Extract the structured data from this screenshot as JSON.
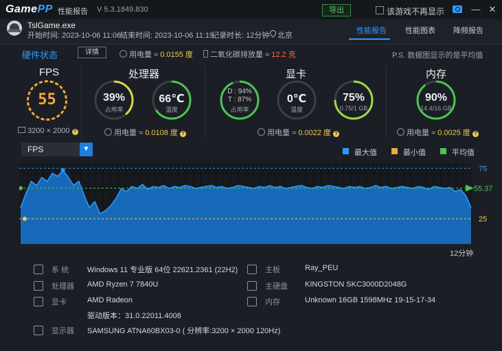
{
  "titlebar": {
    "logo_main": "Game",
    "logo_accent": "PP",
    "title": "性能报告",
    "version": "V 5.3.1849.830",
    "export_label": "导出",
    "checkbox_label": "该游戏不再显示"
  },
  "game": {
    "name": "TslGame.exe",
    "start": "开始时间: 2023-10-06 11:06",
    "end": "结束时间: 2023-10-06 11:19",
    "duration": "记录时长: 12分钟",
    "location": "北京"
  },
  "tabs": [
    "性能报告",
    "性能图表",
    "降频报告"
  ],
  "hw": {
    "title": "硬件状态",
    "detail_btn": "详情",
    "power_label": "用电量 ≈",
    "power_value": "0.0155 度",
    "co2_label": "二氧化碳排放量 ≈",
    "co2_value": "12.2 克",
    "note": "P.S. 数据图显示的是平均值"
  },
  "fps": {
    "title": "FPS",
    "value": "55",
    "resolution": "3200 × 2000"
  },
  "cpu": {
    "title": "处理器",
    "usage_value": "39%",
    "usage_label": "占用率",
    "usage_pct": 39,
    "temp_value": "66℃",
    "temp_label": "温度",
    "temp_pct": 66,
    "power_label": "用电量 ≈",
    "power_value": "0.0108 度"
  },
  "gpu": {
    "title": "显卡",
    "d_line": "D : 94%",
    "t_line": "T : 87%",
    "usage_label": "占用率",
    "usage_pct": 94,
    "temp_value": "0℃",
    "temp_label": "温度",
    "temp_pct": 0,
    "mem_value": "75%",
    "mem_detail": "0.75/1 GB",
    "mem_pct": 75,
    "power_label": "用电量 ≈",
    "power_value": "0.0022 度"
  },
  "ram": {
    "title": "内存",
    "value": "90%",
    "detail": "14.4/16 GB",
    "pct": 90,
    "power_label": "用电量 ≈",
    "power_value": "0.0025 度"
  },
  "chart_select": "FPS",
  "legend": [
    {
      "label": "最大值",
      "color": "#2e9bff"
    },
    {
      "label": "最小值",
      "color": "#f2a93b"
    },
    {
      "label": "平均值",
      "color": "#4cc552"
    }
  ],
  "chart_data": {
    "type": "area",
    "title": "",
    "xlabel": "12分钟",
    "ylabel": "",
    "max_line": 75,
    "avg_line": 55.37,
    "min_line": 25,
    "ylim": [
      0,
      80
    ],
    "series": [
      {
        "name": "FPS",
        "values": [
          36,
          50,
          62,
          58,
          66,
          62,
          70,
          67,
          73,
          66,
          58,
          62,
          48,
          36,
          42,
          30,
          33,
          38,
          45,
          55,
          52,
          57,
          55,
          59,
          54,
          57,
          56,
          58,
          55,
          57,
          56,
          58,
          57,
          55,
          56,
          57,
          58,
          56,
          57,
          55,
          56,
          58,
          57,
          56,
          55,
          57,
          56,
          58,
          56,
          57,
          55,
          56,
          57,
          58,
          56,
          55,
          57,
          56,
          58,
          57,
          56,
          55,
          57,
          56,
          57,
          55,
          56,
          58,
          56,
          57,
          55,
          56,
          57,
          56,
          55,
          57,
          56,
          54,
          57,
          56,
          55,
          56,
          52,
          54,
          48,
          36
        ]
      }
    ]
  },
  "sysinfo": {
    "left": [
      {
        "label": "系 统",
        "value": "Windows 11 专业版 64位 22621.2361 (22H2)"
      },
      {
        "label": "处理器",
        "value": "AMD Ryzen 7 7840U"
      },
      {
        "label": "显卡",
        "value": "AMD Radeon"
      },
      {
        "label": "",
        "value": "驱动版本：31.0.22011.4008"
      },
      {
        "label": "显示器",
        "value": "SAMSUNG ATNA60BX03-0 ( 分辨率:3200 × 2000 120Hz)"
      }
    ],
    "right": [
      {
        "label": "主板",
        "value": "Ray_PEU"
      },
      {
        "label": "主硬盘",
        "value": "KINGSTON SKC3000D2048G"
      },
      {
        "label": "内存",
        "value": "Unknown 16GB 1598MHz 19-15-17-34"
      }
    ]
  }
}
